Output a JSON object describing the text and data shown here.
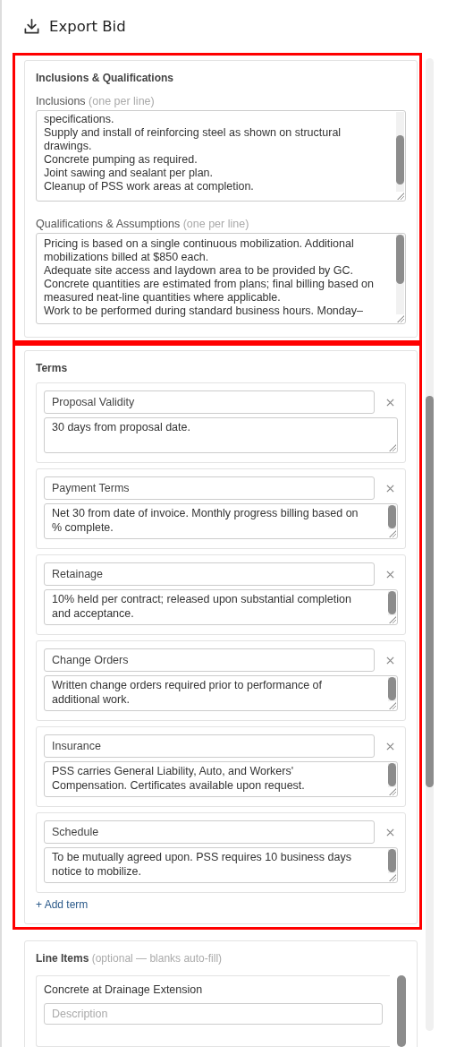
{
  "title": "Export Bid",
  "inclusions_section": {
    "title": "Inclusions & Qualifications",
    "highlighted": true,
    "inclusions": {
      "label": "Inclusions",
      "hint": "(one per line)",
      "lines": [
        "specifications.",
        "Supply and install of reinforcing steel as shown on structural drawings.",
        "Concrete pumping as required.",
        "Joint sawing and sealant per plan.",
        "Cleanup of PSS work areas at completion."
      ]
    },
    "qualifications": {
      "label": "Qualifications & Assumptions",
      "hint": "(one per line)",
      "lines": [
        "Pricing is based on a single continuous mobilization. Additional mobilizations billed at $850 each.",
        "Adequate site access and laydown area to be provided by GC.",
        "Concrete quantities are estimated from plans; final billing based on measured neat-line quantities where applicable.",
        "Work to be performed during standard business hours. Monday–"
      ]
    }
  },
  "terms_section": {
    "title": "Terms",
    "highlighted": true,
    "add_label": "+ Add term",
    "terms": [
      {
        "name": "Proposal Validity",
        "text": "30 days from proposal date.",
        "scrollable": false
      },
      {
        "name": "Payment Terms",
        "text": "Net 30 from date of invoice. Monthly progress billing based on % complete.",
        "scrollable": true
      },
      {
        "name": "Retainage",
        "text": "10% held per contract; released upon substantial completion and acceptance.",
        "scrollable": true
      },
      {
        "name": "Change Orders",
        "text": "Written change orders required prior to performance of additional work.",
        "scrollable": true
      },
      {
        "name": "Insurance",
        "text": "PSS carries General Liability, Auto, and Workers' Compensation. Certificates available upon request.",
        "scrollable": true
      },
      {
        "name": "Schedule",
        "text": "To be mutually agreed upon. PSS requires 10 business days notice to mobilize.",
        "scrollable": true
      }
    ]
  },
  "line_items_section": {
    "title": "Line Items",
    "hint": "(optional — blanks auto-fill)",
    "items": [
      {
        "name": "Concrete at Drainage Extension",
        "description_placeholder": "Description"
      }
    ]
  }
}
